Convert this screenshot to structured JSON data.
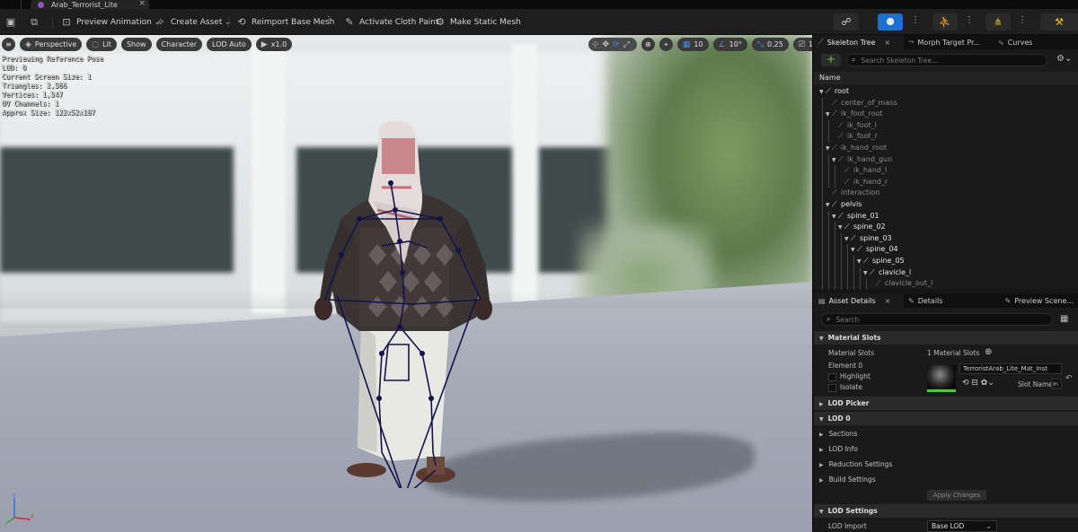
{
  "window": {
    "tab_title": "Arab_Terrorist_Lite"
  },
  "toolbar": {
    "preview_animation": "Preview Animation",
    "create_asset": "Create Asset",
    "reimport": "Reimport Base Mesh",
    "activate_cloth": "Activate Cloth Paint",
    "make_static": "Make Static Mesh"
  },
  "viewport": {
    "perspective": "Perspective",
    "lit": "Lit",
    "show": "Show",
    "character": "Character",
    "lod": "LOD Auto",
    "play_rate": "x1.0",
    "grid_size": "10",
    "rot_snap": "10°",
    "scale_snap": "0.25",
    "camera_speed": "1",
    "stats": [
      "Previewing Reference Pose",
      "LOD: 0",
      "Current Screen Size: 1",
      "Triangles: 2,566",
      "Vertices: 1,547",
      "UV Channels: 1",
      "Approx Size: 122x52x187"
    ]
  },
  "skeleton_panel": {
    "tabs": [
      "Skeleton Tree",
      "Morph Target Pr...",
      "Curves"
    ],
    "search_placeholder": "Search Skeleton Tree...",
    "column": "Name",
    "bones": [
      {
        "name": "root",
        "depth": 0,
        "bright": true,
        "expand": true
      },
      {
        "name": "center_of_mass",
        "depth": 1,
        "bright": false,
        "expand": false
      },
      {
        "name": "ik_foot_root",
        "depth": 1,
        "bright": false,
        "expand": true
      },
      {
        "name": "ik_foot_l",
        "depth": 2,
        "bright": false,
        "expand": false
      },
      {
        "name": "ik_foot_r",
        "depth": 2,
        "bright": false,
        "expand": false
      },
      {
        "name": "ik_hand_root",
        "depth": 1,
        "bright": false,
        "expand": true
      },
      {
        "name": "ik_hand_gun",
        "depth": 2,
        "bright": false,
        "expand": true
      },
      {
        "name": "ik_hand_l",
        "depth": 3,
        "bright": false,
        "expand": false
      },
      {
        "name": "ik_hand_r",
        "depth": 3,
        "bright": false,
        "expand": false
      },
      {
        "name": "interaction",
        "depth": 1,
        "bright": false,
        "expand": false
      },
      {
        "name": "pelvis",
        "depth": 1,
        "bright": true,
        "expand": true
      },
      {
        "name": "spine_01",
        "depth": 2,
        "bright": true,
        "expand": true
      },
      {
        "name": "spine_02",
        "depth": 3,
        "bright": true,
        "expand": true
      },
      {
        "name": "spine_03",
        "depth": 4,
        "bright": true,
        "expand": true
      },
      {
        "name": "spine_04",
        "depth": 5,
        "bright": true,
        "expand": true
      },
      {
        "name": "spine_05",
        "depth": 6,
        "bright": true,
        "expand": true
      },
      {
        "name": "clavicle_l",
        "depth": 7,
        "bright": true,
        "expand": true
      },
      {
        "name": "clavicle_out_l",
        "depth": 8,
        "bright": false,
        "expand": false
      }
    ]
  },
  "details_panel": {
    "tabs": [
      "Asset Details",
      "Details",
      "Preview Scene..."
    ],
    "search_placeholder": "Search",
    "material_slots_header": "Material Slots",
    "material_slots_label": "Material Slots",
    "material_slots_count": "1 Material Slots",
    "element": "Element 0",
    "highlight": "Highlight",
    "isolate": "Isolate",
    "material_name": "TerroristArab_Lite_Mat_Inst",
    "slot_name_label": "Slot Name",
    "slot_name_value": "In",
    "lod_picker": "LOD Picker",
    "lod0": "LOD 0",
    "sections": "Sections",
    "lod_info": "LOD Info",
    "reduction_settings": "Reduction Settings",
    "build_settings": "Build Settings",
    "apply_changes": "Apply Changes",
    "lod_settings": "LOD Settings",
    "lod_import_label": "LOD Import",
    "lod_import_value": "Base LOD"
  }
}
